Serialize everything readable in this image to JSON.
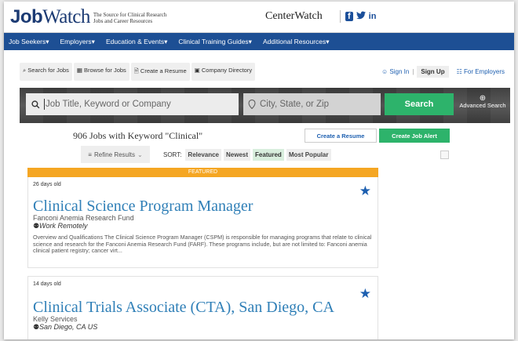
{
  "brand": {
    "logo_job": "Job",
    "logo_watch": "Watch",
    "tagline_1": "The Source for Clinical Research",
    "tagline_2": "Jobs and Career Resources",
    "partner": "CenterWatch",
    "social_icons": [
      "facebook-icon",
      "twitter-icon",
      "linkedin-icon"
    ],
    "social_labels": [
      "f",
      "❀",
      "in"
    ]
  },
  "nav": {
    "items": [
      {
        "label": "Job Seekers▾"
      },
      {
        "label": "Employers▾"
      },
      {
        "label": "Education & Events▾"
      },
      {
        "label": "Clinical Training Guides▾"
      },
      {
        "label": "Additional Resources▾"
      }
    ]
  },
  "subnav": {
    "search_jobs": "Search for Jobs",
    "browse_jobs": "Browse for Jobs",
    "create_resume": "Create a Resume",
    "company_directory": "Company Directory",
    "sign_in": "Sign In",
    "sep": "|",
    "sign_up": "Sign Up",
    "for_employers": "For Employers"
  },
  "search": {
    "keyword_placeholder": "Job Title, Keyword or Company",
    "location_placeholder": "City, State, or Zip",
    "search_label": "Search",
    "advanced_label": "Advanced Search"
  },
  "results": {
    "heading": "906 Jobs with Keyword \"Clinical\"",
    "create_resume": "Create a Resume",
    "create_alert": "Create Job Alert",
    "refine": "Refine Results",
    "sort_label": "SORT:",
    "sort_options": [
      {
        "label": "Relevance",
        "active": false
      },
      {
        "label": "Newest",
        "active": false
      },
      {
        "label": "Featured",
        "active": true
      },
      {
        "label": "Most Popular",
        "active": false
      }
    ]
  },
  "jobs": [
    {
      "featured_label": "FEATURED",
      "age": "26 days old",
      "title": "Clinical Science Program Manager",
      "company": "Fanconi Anemia Research Fund",
      "location": "Work Remotely",
      "description": "Overview and Qualifications The Clinical Science Program Manager (CSPM) is responsible for managing programs that relate to clinical science and research for the Fanconi Anemia Research Fund (FARF). These programs include, but are not limited to: Fanconi anemia clinical patient registry; cancer virt..."
    },
    {
      "age": "14 days old",
      "title": "Clinical Trials Associate (CTA), San Diego, CA",
      "company": "Kelly Services",
      "location": "San Diego, CA US"
    }
  ],
  "colors": {
    "nav_bg": "#1d4f94",
    "accent_green": "#2db36b",
    "featured_orange": "#f5a623",
    "link_blue": "#2f7fb7"
  }
}
